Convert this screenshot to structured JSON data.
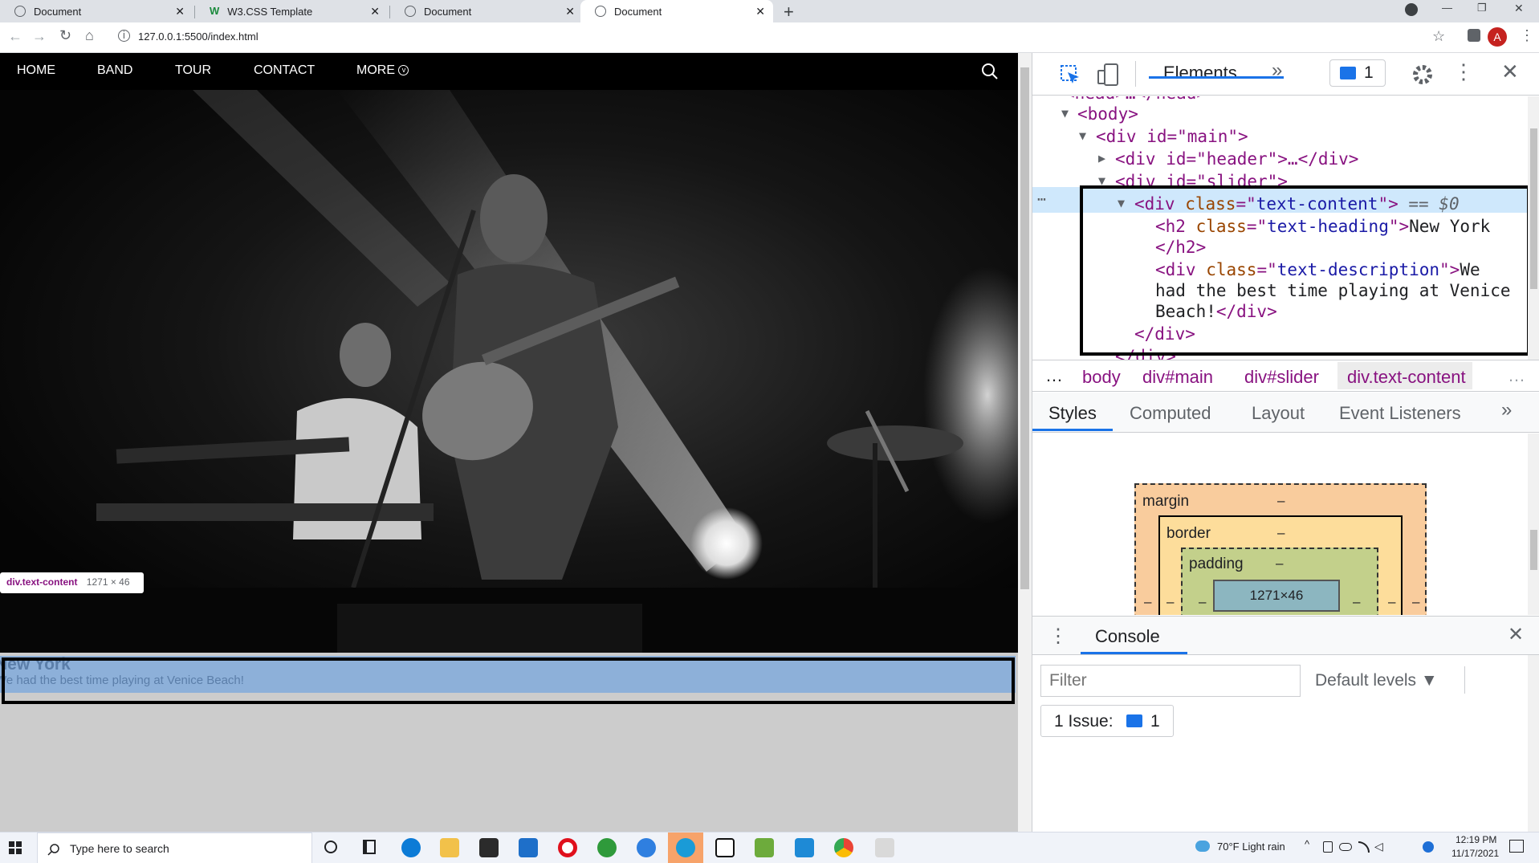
{
  "browser": {
    "tabs": [
      {
        "title": "Document",
        "close": "✕"
      },
      {
        "title": "W3.CSS Template",
        "favicon": "W",
        "close": "✕"
      },
      {
        "title": "Document",
        "close": "✕"
      },
      {
        "title": "Document",
        "close": "✕"
      }
    ],
    "new_tab": "+",
    "url": "127.0.0.1:5500/index.html",
    "profile_initial": "A",
    "window_controls": [
      "—",
      "❐",
      "✕"
    ]
  },
  "site": {
    "nav": [
      "HOME",
      "BAND",
      "TOUR",
      "CONTACT",
      "MORE"
    ],
    "search_icon": "search-icon",
    "heading": "New York",
    "description": "We had the best time playing at Venice Beach!",
    "tooltip": {
      "name": "div.text-content",
      "size": "1271 × 46"
    }
  },
  "devtools": {
    "tabs": {
      "active": "Elements",
      "issues_count": "1"
    },
    "dom": {
      "head_line": "<head>…</head>",
      "body_open": "<body>",
      "main_open": "<div id=\"main\">",
      "header_line": "<div id=\"header\">…</div>",
      "slider_open": "<div id=\"slider\">",
      "selected_suffix": "== $0",
      "h2_tag": "h2",
      "h2_class": "text-heading",
      "h2_text": "New York",
      "h2_close": "</h2>",
      "desc_class": "text-description",
      "desc_text_1": "We",
      "desc_text_2": "had the best time playing at Venice",
      "desc_text_3": "Beach!",
      "div_close": "</div>"
    },
    "breadcrumbs": [
      "body",
      "div#main",
      "div#slider",
      "div.text-content"
    ],
    "styles_tabs": [
      "Styles",
      "Computed",
      "Layout",
      "Event Listeners"
    ],
    "box_model": {
      "margin": "margin",
      "border": "border",
      "padding": "padding",
      "dash": "–",
      "content": "1271×46"
    },
    "console": {
      "title": "Console",
      "filter_placeholder": "Filter",
      "levels": "Default levels ▼",
      "issue_label": "1 Issue:",
      "issue_count": "1"
    }
  },
  "taskbar": {
    "search_placeholder": "Type here to search",
    "weather": "70°F  Light rain",
    "time": "12:19 PM",
    "date": "11/17/2021"
  }
}
